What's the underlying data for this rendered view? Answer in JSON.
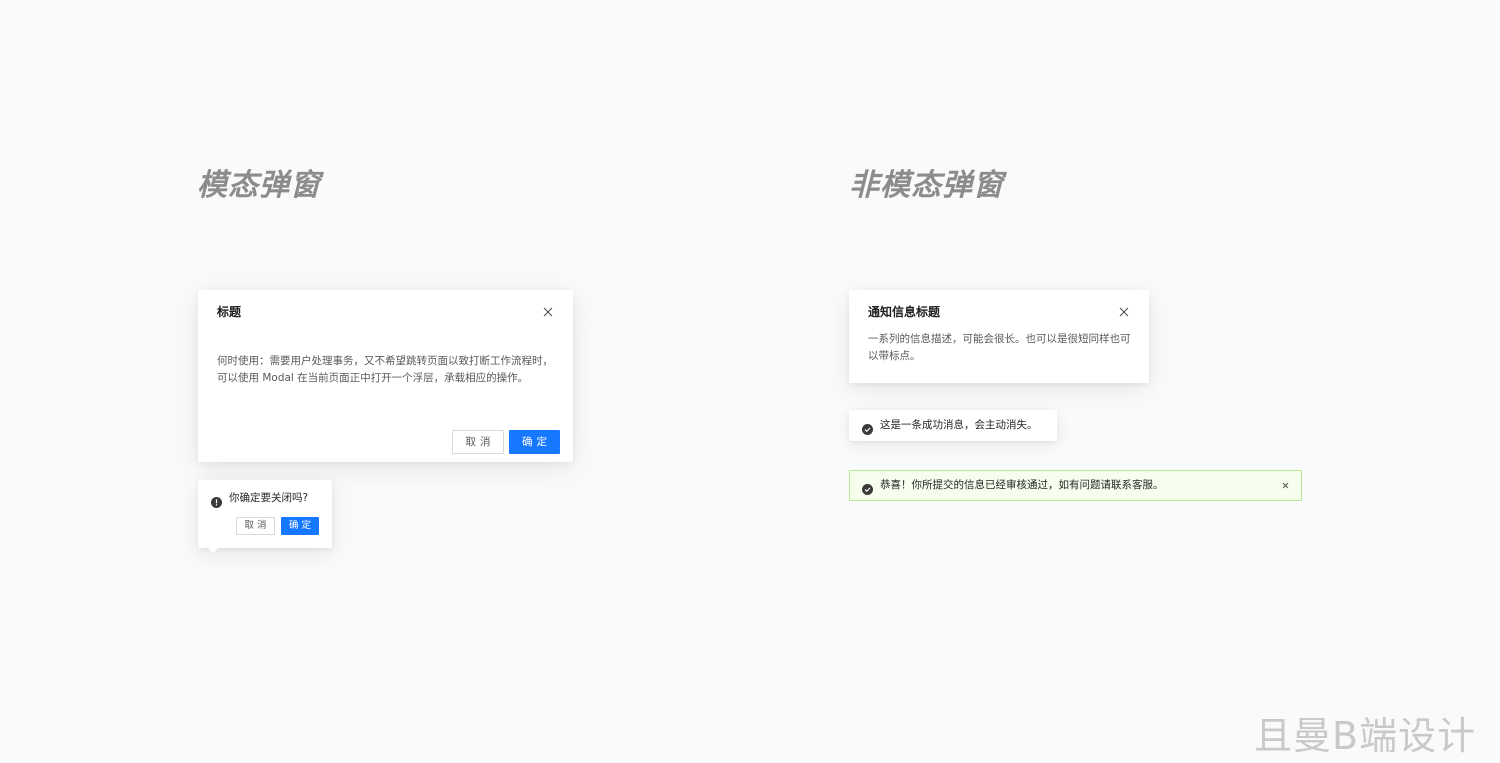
{
  "sections": {
    "modal_heading": "模态弹窗",
    "nonmodal_heading": "非模态弹窗"
  },
  "modal": {
    "title": "标题",
    "body": "何时使用：需要用户处理事务，又不希望跳转页面以致打断工作流程时，可以使用 Modal 在当前页面正中打开一个浮层，承载相应的操作。",
    "cancel_label": "取消",
    "ok_label": "确定",
    "close_icon": "close-icon"
  },
  "popconfirm": {
    "title": "你确定要关闭吗?",
    "icon": "exclamation-circle-icon",
    "cancel_label": "取消",
    "ok_label": "确定"
  },
  "notification": {
    "title": "通知信息标题",
    "description": "一系列的信息描述，可能会很长。也可以是很短同样也可以带标点。",
    "close_icon": "close-icon"
  },
  "message": {
    "text": "这是一条成功消息，会主动消失。",
    "icon": "check-circle-icon"
  },
  "alert": {
    "text": "恭喜！你所提交的信息已经审核通过，如有问题请联系客服。",
    "icon": "check-circle-icon",
    "close_icon": "close-icon"
  },
  "watermark": "且曼B端设计",
  "colors": {
    "primary": "#1677ff",
    "alert_bg": "#f6ffed",
    "alert_border": "#b7eb8f",
    "heading": "#8c8c8c",
    "page_bg": "#f9fafb"
  }
}
